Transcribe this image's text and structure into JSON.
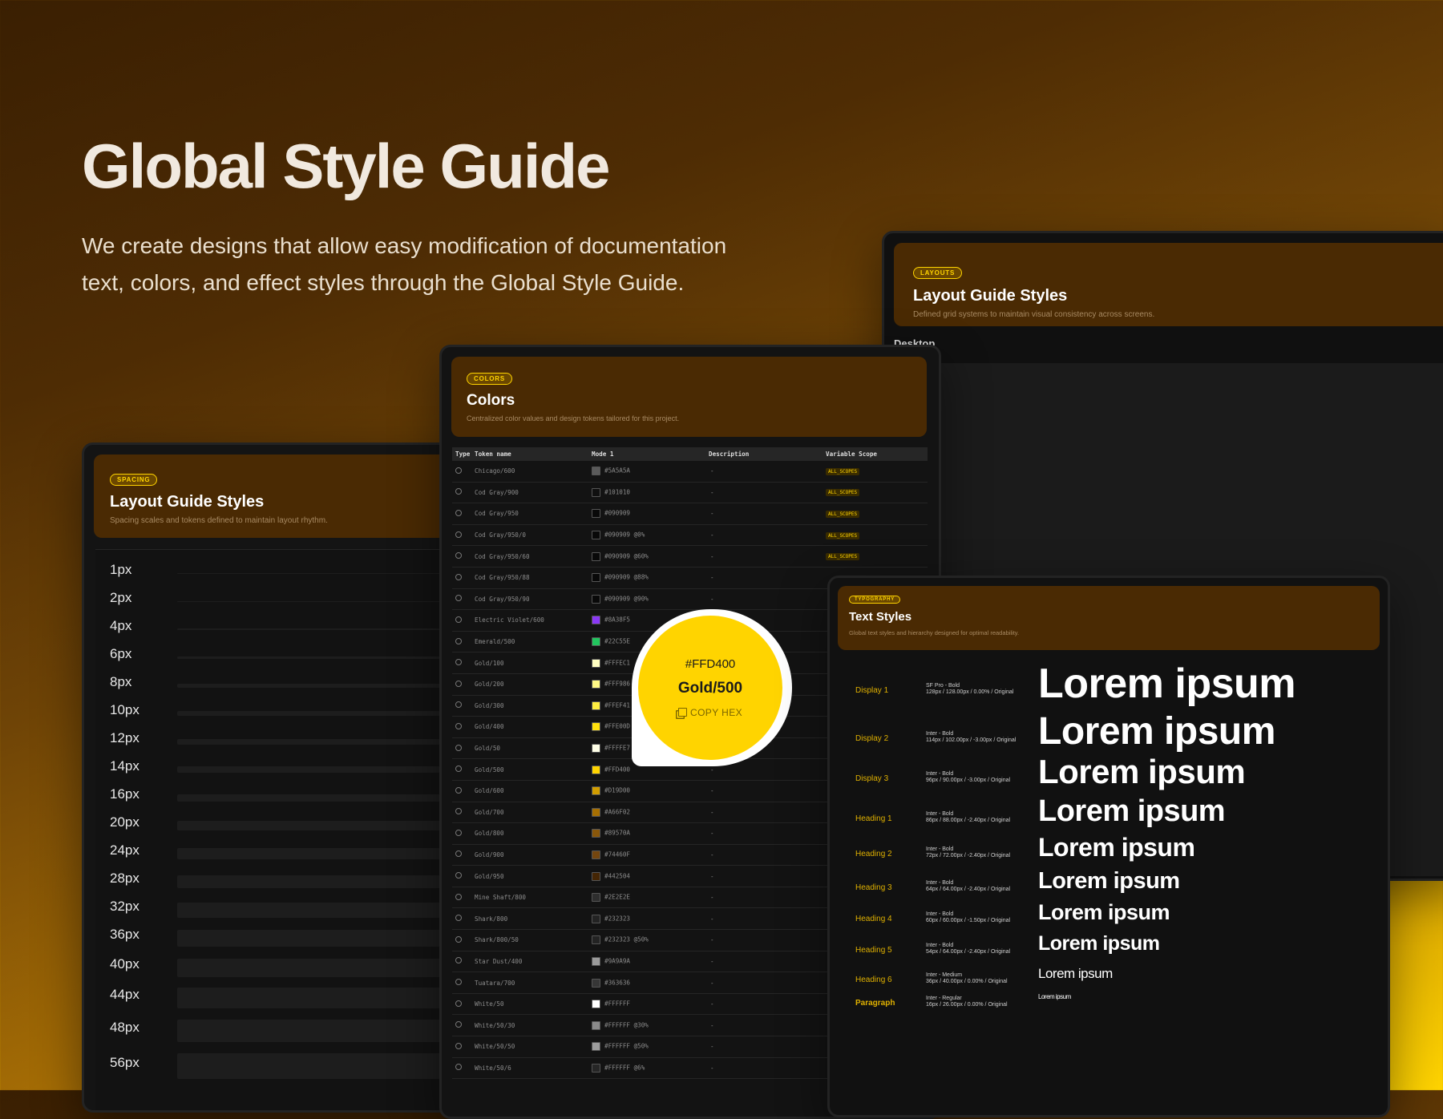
{
  "hero": {
    "title": "Global Style Guide",
    "subtitle": "We create designs that allow easy modification of documentation text, colors, and effect styles through the Global Style Guide."
  },
  "spacing": {
    "badge": "SPACING",
    "title": "Layout Guide Styles",
    "description": "Spacing scales and tokens defined to maintain layout rhythm.",
    "items": [
      "1px",
      "2px",
      "4px",
      "6px",
      "8px",
      "10px",
      "12px",
      "14px",
      "16px",
      "20px",
      "24px",
      "28px",
      "32px",
      "36px",
      "40px",
      "44px",
      "48px",
      "56px"
    ]
  },
  "layouts": {
    "badge": "LAYOUTS",
    "title": "Layout Guide Styles",
    "description": "Defined grid systems to maintain visual consistency across screens.",
    "tab": "Desktop"
  },
  "colors": {
    "badge": "COLORS",
    "title": "Colors",
    "description": "Centralized color values and design tokens tailored for this project.",
    "headers": {
      "type": "Type",
      "token": "Token name",
      "mode": "Mode 1",
      "desc": "Description",
      "scope": "Variable Scope"
    },
    "rows": [
      {
        "token": "Chicago/600",
        "value": "#5A5A5A",
        "swatch": "#5A5A5A",
        "desc": "-",
        "scope": "ALL_SCOPES"
      },
      {
        "token": "Cod Gray/900",
        "value": "#101010",
        "swatch": "#101010",
        "desc": "-",
        "scope": "ALL_SCOPES"
      },
      {
        "token": "Cod Gray/950",
        "value": "#090909",
        "swatch": "#090909",
        "desc": "-",
        "scope": "ALL_SCOPES"
      },
      {
        "token": "Cod Gray/950/0",
        "value": "#090909 @0%",
        "swatch": "#090909",
        "desc": "-",
        "scope": "ALL_SCOPES"
      },
      {
        "token": "Cod Gray/950/60",
        "value": "#090909 @60%",
        "swatch": "#090909",
        "desc": "-",
        "scope": "ALL_SCOPES"
      },
      {
        "token": "Cod Gray/950/88",
        "value": "#090909 @88%",
        "swatch": "#090909",
        "desc": "-",
        "scope": ""
      },
      {
        "token": "Cod Gray/950/90",
        "value": "#090909 @90%",
        "swatch": "#090909",
        "desc": "-",
        "scope": ""
      },
      {
        "token": "Electric Violet/600",
        "value": "#8A38F5",
        "swatch": "#8A38F5",
        "desc": "-",
        "scope": ""
      },
      {
        "token": "Emerald/500",
        "value": "#22C55E",
        "swatch": "#22C55E",
        "desc": "-",
        "scope": ""
      },
      {
        "token": "Gold/100",
        "value": "#FFFEC1",
        "swatch": "#FFFEC1",
        "desc": "-",
        "scope": ""
      },
      {
        "token": "Gold/200",
        "value": "#FFF986",
        "swatch": "#FFF986",
        "desc": "-",
        "scope": ""
      },
      {
        "token": "Gold/300",
        "value": "#FFEF41",
        "swatch": "#FFEF41",
        "desc": "-",
        "scope": ""
      },
      {
        "token": "Gold/400",
        "value": "#FFE00D",
        "swatch": "#FFE00D",
        "desc": "-",
        "scope": ""
      },
      {
        "token": "Gold/50",
        "value": "#FFFFE7",
        "swatch": "#FFFFE7",
        "desc": "-",
        "scope": ""
      },
      {
        "token": "Gold/500",
        "value": "#FFD400",
        "swatch": "#FFD400",
        "desc": "-",
        "scope": ""
      },
      {
        "token": "Gold/600",
        "value": "#D19D00",
        "swatch": "#D19D00",
        "desc": "-",
        "scope": ""
      },
      {
        "token": "Gold/700",
        "value": "#A66F02",
        "swatch": "#A66F02",
        "desc": "-",
        "scope": ""
      },
      {
        "token": "Gold/800",
        "value": "#89570A",
        "swatch": "#89570A",
        "desc": "-",
        "scope": ""
      },
      {
        "token": "Gold/900",
        "value": "#74460F",
        "swatch": "#74460F",
        "desc": "-",
        "scope": ""
      },
      {
        "token": "Gold/950",
        "value": "#442504",
        "swatch": "#442504",
        "desc": "-",
        "scope": ""
      },
      {
        "token": "Mine Shaft/800",
        "value": "#2E2E2E",
        "swatch": "#2E2E2E",
        "desc": "-",
        "scope": ""
      },
      {
        "token": "Shark/800",
        "value": "#232323",
        "swatch": "#232323",
        "desc": "-",
        "scope": ""
      },
      {
        "token": "Shark/800/50",
        "value": "#232323 @50%",
        "swatch": "#232323",
        "desc": "-",
        "scope": ""
      },
      {
        "token": "Star Dust/400",
        "value": "#9A9A9A",
        "swatch": "#9A9A9A",
        "desc": "-",
        "scope": ""
      },
      {
        "token": "Tuatara/700",
        "value": "#363636",
        "swatch": "#363636",
        "desc": "-",
        "scope": ""
      },
      {
        "token": "White/50",
        "value": "#FFFFFF",
        "swatch": "#FFFFFF",
        "desc": "-",
        "scope": ""
      },
      {
        "token": "White/50/30",
        "value": "#FFFFFF @30%",
        "swatch": "#8a8a8a",
        "desc": "-",
        "scope": ""
      },
      {
        "token": "White/50/50",
        "value": "#FFFFFF @50%",
        "swatch": "#9c9c9c",
        "desc": "-",
        "scope": ""
      },
      {
        "token": "White/50/6",
        "value": "#FFFFFF @6%",
        "swatch": "#262626",
        "desc": "-",
        "scope": ""
      }
    ]
  },
  "bubble": {
    "hex": "#FFD400",
    "name": "Gold/500",
    "copy_label": "COPY HEX"
  },
  "typography": {
    "badge": "TYPOGRAPHY",
    "title": "Text Styles",
    "description": "Global text styles and hierarchy designed for optimal readability.",
    "rows": [
      {
        "name": "Display 1",
        "spec1": "SF Pro - Bold",
        "spec2": "128px / 128.00px / 0.00% / Original",
        "sample": "Lorem ipsum"
      },
      {
        "name": "Display 2",
        "spec1": "Inter - Bold",
        "spec2": "114px / 102.00px / -3.00px / Original",
        "sample": "Lorem ipsum"
      },
      {
        "name": "Display 3",
        "spec1": "Inter - Bold",
        "spec2": "96px / 90.00px / -3.00px / Original",
        "sample": "Lorem ipsum"
      },
      {
        "name": "Heading 1",
        "spec1": "Inter - Bold",
        "spec2": "86px / 88.00px / -2.40px / Original",
        "sample": "Lorem ipsum"
      },
      {
        "name": "Heading 2",
        "spec1": "Inter - Bold",
        "spec2": "72px / 72.00px / -2.40px / Original",
        "sample": "Lorem ipsum"
      },
      {
        "name": "Heading 3",
        "spec1": "Inter - Bold",
        "spec2": "64px / 64.00px / -2.40px / Original",
        "sample": "Lorem ipsum"
      },
      {
        "name": "Heading 4",
        "spec1": "Inter - Bold",
        "spec2": "60px / 60.00px / -1.50px / Original",
        "sample": "Lorem ipsum"
      },
      {
        "name": "Heading 5",
        "spec1": "Inter - Bold",
        "spec2": "54px / 64.00px / -2.40px / Original",
        "sample": "Lorem ipsum"
      },
      {
        "name": "Heading 6",
        "spec1": "Inter - Medium",
        "spec2": "36px / 40.00px / 0.00% / Original",
        "sample": "Lorem ipsum"
      },
      {
        "name": "Paragraph",
        "spec1": "Inter - Regular",
        "spec2": "16px / 26.00px / 0.00% / Original",
        "sample": "Lorem ipsum"
      }
    ]
  }
}
